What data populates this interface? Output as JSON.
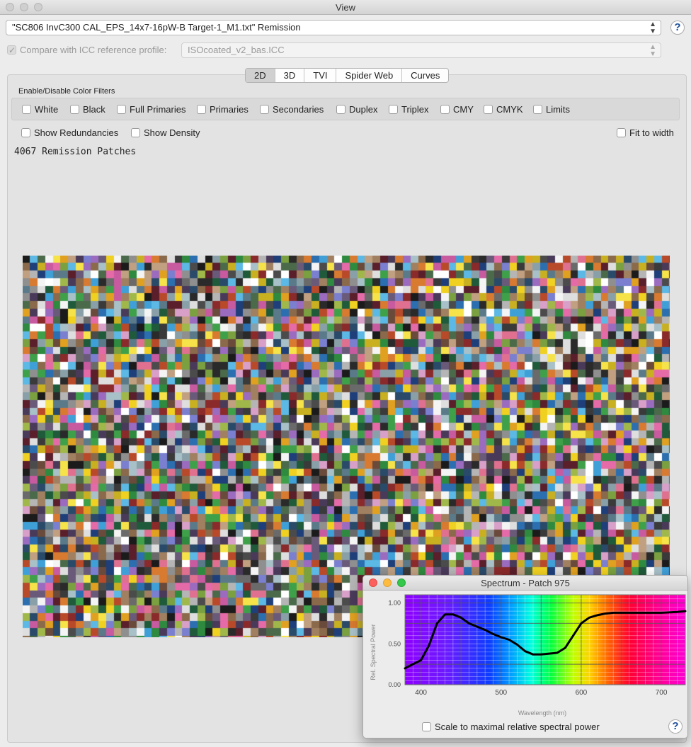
{
  "window": {
    "title": "View"
  },
  "dataset": {
    "selected": "\"SC806 InvC300 CAL_EPS_14x7-16pW-B Target-1_M1.txt\" Remission"
  },
  "compare": {
    "label": "Compare with ICC reference profile:",
    "checked": true,
    "profile": "ISOcoated_v2_bas.ICC"
  },
  "tabs": [
    {
      "label": "2D",
      "active": true
    },
    {
      "label": "3D",
      "active": false
    },
    {
      "label": "TVI",
      "active": false
    },
    {
      "label": "Spider Web",
      "active": false
    },
    {
      "label": "Curves",
      "active": false
    }
  ],
  "filters": {
    "title": "Enable/Disable Color Filters",
    "items": [
      "White",
      "Black",
      "Full Primaries",
      "Primaries",
      "Secondaries",
      "Duplex",
      "Triplex",
      "CMY",
      "CMYK",
      "Limits"
    ]
  },
  "options": {
    "show_redundancies": "Show Redundancies",
    "show_density": "Show Density",
    "fit_to_width": "Fit to width"
  },
  "patch_count": "4067 Remission Patches",
  "icons": {
    "help": "help-icon",
    "checkbox": "checkbox-icon",
    "select_arrows": "select-arrows-icon"
  },
  "spectrum": {
    "title": "Spectrum - Patch 975",
    "scale_option": "Scale to maximal relative spectral power",
    "help_glyph": "?"
  },
  "chart_data": {
    "type": "line",
    "title": "",
    "xlabel": "Wavelength (nm)",
    "ylabel": "Rel. Spectral Power",
    "xlim": [
      380,
      730
    ],
    "ylim": [
      0,
      1.1
    ],
    "x_ticks": [
      "400",
      "500",
      "600",
      "700"
    ],
    "y_ticks": [
      "0.00",
      "0.50",
      "1.00"
    ],
    "grid": true,
    "background": "visible-spectrum",
    "series": [
      {
        "x": [
          380,
          390,
          400,
          410,
          420,
          430,
          440,
          450,
          460,
          470,
          480,
          490,
          500,
          510,
          520,
          530,
          540,
          550,
          560,
          570,
          580,
          590,
          600,
          610,
          620,
          630,
          640,
          660,
          680,
          700,
          720,
          730
        ],
        "y": [
          0.2,
          0.25,
          0.3,
          0.48,
          0.75,
          0.86,
          0.86,
          0.82,
          0.75,
          0.71,
          0.67,
          0.62,
          0.58,
          0.55,
          0.49,
          0.41,
          0.37,
          0.37,
          0.38,
          0.39,
          0.45,
          0.6,
          0.75,
          0.82,
          0.85,
          0.87,
          0.88,
          0.88,
          0.88,
          0.88,
          0.89,
          0.9
        ],
        "color": "#000000"
      }
    ]
  }
}
